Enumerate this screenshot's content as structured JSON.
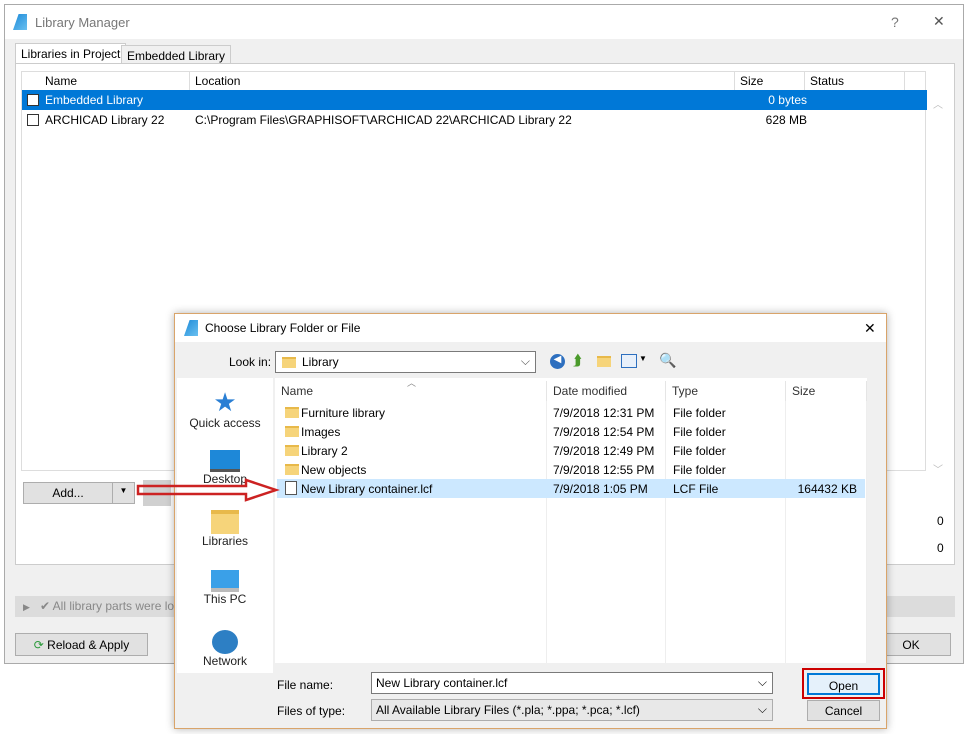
{
  "main": {
    "title": "Library Manager",
    "help": "?",
    "close": "✕",
    "tabs": [
      "Libraries in Project",
      "Embedded Library"
    ],
    "columns": [
      "Name",
      "Location",
      "Size",
      "Status"
    ],
    "rows": [
      {
        "name": "Embedded Library",
        "location": "",
        "size": "0 bytes"
      },
      {
        "name": "ARCHICAD Library 22",
        "location": "C:\\Program Files\\GRAPHISOFT\\ARCHICAD 22\\ARCHICAD Library 22",
        "size": "628 MB"
      }
    ],
    "add_label": "Add...",
    "counts": [
      "0",
      "0"
    ],
    "status_text": "All library parts were lo",
    "reload_label": "Reload & Apply",
    "ok_label": "OK"
  },
  "dialog": {
    "title": "Choose Library Folder or File",
    "close": "✕",
    "look_in_label": "Look in:",
    "look_in_value": "Library",
    "places": [
      "Quick access",
      "Desktop",
      "Libraries",
      "This PC",
      "Network"
    ],
    "columns": [
      "Name",
      "Date modified",
      "Type",
      "Size"
    ],
    "files": [
      {
        "name": "Furniture library",
        "date": "7/9/2018 12:31 PM",
        "type": "File folder",
        "size": ""
      },
      {
        "name": "Images",
        "date": "7/9/2018 12:54 PM",
        "type": "File folder",
        "size": ""
      },
      {
        "name": "Library 2",
        "date": "7/9/2018 12:49 PM",
        "type": "File folder",
        "size": ""
      },
      {
        "name": "New objects",
        "date": "7/9/2018 12:55 PM",
        "type": "File folder",
        "size": ""
      },
      {
        "name": "New Library container.lcf",
        "date": "7/9/2018 1:05 PM",
        "type": "LCF File",
        "size": "164432 KB"
      }
    ],
    "file_name_label": "File name:",
    "file_name_value": "New Library container.lcf",
    "file_type_label": "Files of type:",
    "file_type_value": "All Available Library Files (*.pla; *.ppa; *.pca; *.lcf)",
    "open_label": "Open",
    "cancel_label": "Cancel"
  },
  "colors": {
    "selection": "#0078d7",
    "file_selection": "#cce8ff",
    "highlight": "#cc0000"
  }
}
